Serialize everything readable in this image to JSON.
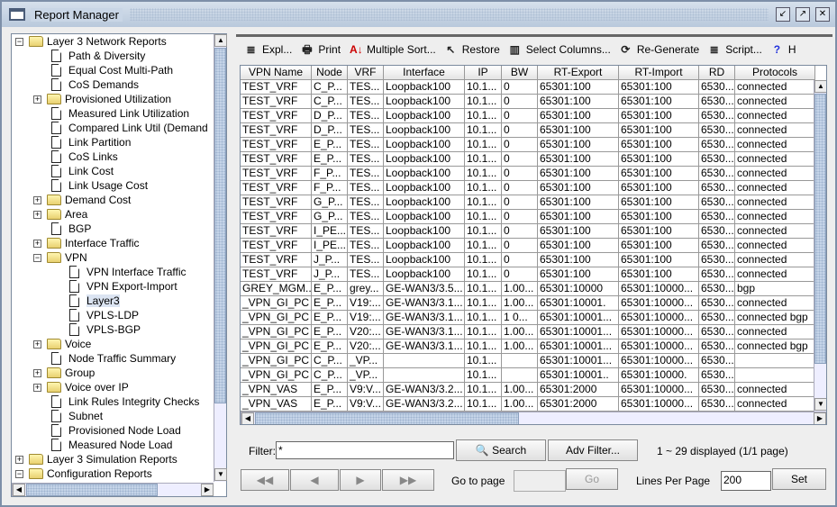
{
  "window": {
    "title": "Report Manager",
    "controls": [
      "minimize",
      "maximize",
      "close"
    ]
  },
  "tree": [
    {
      "label": "Layer 3 Network Reports",
      "type": "folder",
      "level": 0,
      "expanded": true
    },
    {
      "label": "Path & Diversity",
      "type": "doc",
      "level": 1
    },
    {
      "label": "Equal Cost Multi-Path",
      "type": "doc",
      "level": 1
    },
    {
      "label": "CoS Demands",
      "type": "doc",
      "level": 1
    },
    {
      "label": "Provisioned Utilization",
      "type": "folder",
      "level": 1,
      "expanded": false
    },
    {
      "label": "Measured Link Utilization",
      "type": "doc",
      "level": 1
    },
    {
      "label": "Compared Link Util (Demand",
      "type": "doc",
      "level": 1
    },
    {
      "label": "Link Partition",
      "type": "doc",
      "level": 1
    },
    {
      "label": "CoS Links",
      "type": "doc",
      "level": 1
    },
    {
      "label": "Link Cost",
      "type": "doc",
      "level": 1
    },
    {
      "label": "Link Usage Cost",
      "type": "doc",
      "level": 1
    },
    {
      "label": "Demand Cost",
      "type": "folder",
      "level": 1,
      "expanded": false
    },
    {
      "label": "Area",
      "type": "folder",
      "level": 1,
      "expanded": false
    },
    {
      "label": "BGP",
      "type": "doc",
      "level": 1
    },
    {
      "label": "Interface Traffic",
      "type": "folder",
      "level": 1,
      "expanded": false
    },
    {
      "label": "VPN",
      "type": "folder",
      "level": 1,
      "expanded": true
    },
    {
      "label": "VPN Interface Traffic",
      "type": "doc",
      "level": 2
    },
    {
      "label": "VPN Export-Import",
      "type": "doc",
      "level": 2
    },
    {
      "label": "Layer3",
      "type": "doc",
      "level": 2,
      "selected": true
    },
    {
      "label": "VPLS-LDP",
      "type": "doc",
      "level": 2
    },
    {
      "label": "VPLS-BGP",
      "type": "doc",
      "level": 2
    },
    {
      "label": "Voice",
      "type": "folder",
      "level": 1,
      "expanded": false
    },
    {
      "label": "Node Traffic Summary",
      "type": "doc",
      "level": 1
    },
    {
      "label": "Group",
      "type": "folder",
      "level": 1,
      "expanded": false
    },
    {
      "label": "Voice over IP",
      "type": "folder",
      "level": 1,
      "expanded": false
    },
    {
      "label": "Link Rules Integrity Checks",
      "type": "doc",
      "level": 1
    },
    {
      "label": "Subnet",
      "type": "doc",
      "level": 1
    },
    {
      "label": "Provisioned Node Load",
      "type": "doc",
      "level": 1
    },
    {
      "label": "Measured Node Load",
      "type": "doc",
      "level": 1
    },
    {
      "label": "Layer 3 Simulation Reports",
      "type": "folder",
      "level": 0,
      "expanded": false
    },
    {
      "label": "Configuration Reports",
      "type": "folder",
      "level": 0,
      "expanded": true
    }
  ],
  "toolbar": [
    {
      "label": "Expl...",
      "icon": "document-icon",
      "glyph": "≣"
    },
    {
      "label": "Print",
      "icon": "printer-icon",
      "glyph": "🖶"
    },
    {
      "label": "Multiple Sort...",
      "icon": "sort-icon",
      "glyph": "A↓"
    },
    {
      "label": "Restore",
      "icon": "restore-icon",
      "glyph": "↖"
    },
    {
      "label": "Select Columns...",
      "icon": "columns-icon",
      "glyph": "▥"
    },
    {
      "label": "Re-Generate",
      "icon": "refresh-icon",
      "glyph": "⟳"
    },
    {
      "label": "Script...",
      "icon": "script-icon",
      "glyph": "≣"
    },
    {
      "label": "H",
      "icon": "help-icon",
      "glyph": "?"
    }
  ],
  "table": {
    "columns": [
      "VPN Name",
      "Node",
      "VRF",
      "Interface",
      "IP",
      "BW",
      "RT-Export",
      "RT-Import",
      "RD",
      "Protocols"
    ],
    "rows": [
      [
        "TEST_VRF",
        "C_P...",
        "TES...",
        "Loopback100",
        "10.1...",
        "0",
        "65301:100",
        "65301:100",
        "6530...",
        "connected"
      ],
      [
        "TEST_VRF",
        "C_P...",
        "TES...",
        "Loopback100",
        "10.1...",
        "0",
        "65301:100",
        "65301:100",
        "6530...",
        "connected"
      ],
      [
        "TEST_VRF",
        "D_P...",
        "TES...",
        "Loopback100",
        "10.1...",
        "0",
        "65301:100",
        "65301:100",
        "6530...",
        "connected"
      ],
      [
        "TEST_VRF",
        "D_P...",
        "TES...",
        "Loopback100",
        "10.1...",
        "0",
        "65301:100",
        "65301:100",
        "6530...",
        "connected"
      ],
      [
        "TEST_VRF",
        "E_P...",
        "TES...",
        "Loopback100",
        "10.1...",
        "0",
        "65301:100",
        "65301:100",
        "6530...",
        "connected"
      ],
      [
        "TEST_VRF",
        "E_P...",
        "TES...",
        "Loopback100",
        "10.1...",
        "0",
        "65301:100",
        "65301:100",
        "6530...",
        "connected"
      ],
      [
        "TEST_VRF",
        "F_P...",
        "TES...",
        "Loopback100",
        "10.1...",
        "0",
        "65301:100",
        "65301:100",
        "6530...",
        "connected"
      ],
      [
        "TEST_VRF",
        "F_P...",
        "TES...",
        "Loopback100",
        "10.1...",
        "0",
        "65301:100",
        "65301:100",
        "6530...",
        "connected"
      ],
      [
        "TEST_VRF",
        "G_P...",
        "TES...",
        "Loopback100",
        "10.1...",
        "0",
        "65301:100",
        "65301:100",
        "6530...",
        "connected"
      ],
      [
        "TEST_VRF",
        "G_P...",
        "TES...",
        "Loopback100",
        "10.1...",
        "0",
        "65301:100",
        "65301:100",
        "6530...",
        "connected"
      ],
      [
        "TEST_VRF",
        "I_PE...",
        "TES...",
        "Loopback100",
        "10.1...",
        "0",
        "65301:100",
        "65301:100",
        "6530...",
        "connected"
      ],
      [
        "TEST_VRF",
        "I_PE...",
        "TES...",
        "Loopback100",
        "10.1...",
        "0",
        "65301:100",
        "65301:100",
        "6530...",
        "connected"
      ],
      [
        "TEST_VRF",
        "J_P...",
        "TES...",
        "Loopback100",
        "10.1...",
        "0",
        "65301:100",
        "65301:100",
        "6530...",
        "connected"
      ],
      [
        "TEST_VRF",
        "J_P...",
        "TES...",
        "Loopback100",
        "10.1...",
        "0",
        "65301:100",
        "65301:100",
        "6530...",
        "connected"
      ],
      [
        "GREY_MGM...",
        "E_P...",
        "grey...",
        "GE-WAN3/3.5...",
        "10.1...",
        "1.00...",
        "65301:10000",
        "65301:10000...",
        "6530...",
        "bgp"
      ],
      [
        "_VPN_GI_PC",
        "E_P...",
        "V19:...",
        "GE-WAN3/3.1...",
        "10.1...",
        "1.00...",
        "65301:10001.",
        "65301:10000...",
        "6530...",
        "connected"
      ],
      [
        "_VPN_GI_PC",
        "E_P...",
        "V19:...",
        "GE-WAN3/3.1...",
        "10.1...",
        "1   0...",
        "65301:10001...",
        "65301:10000...",
        "6530...",
        "connected bgp"
      ],
      [
        "_VPN_GI_PC",
        "E_P...",
        "V20:...",
        "GE-WAN3/3.1...",
        "10.1...",
        "1.00...",
        "65301:10001...",
        "65301:10000...",
        "6530...",
        "connected"
      ],
      [
        "_VPN_GI_PC",
        "E_P...",
        "V20:...",
        "GE-WAN3/3.1...",
        "10.1...",
        "1.00...",
        "65301:10001...",
        "65301:10000...",
        "6530...",
        "connected bgp"
      ],
      [
        "_VPN_GI_PC",
        "C_P...",
        "_VP...",
        "",
        "10.1...",
        "",
        "65301:10001...",
        "65301:10000...",
        "6530...",
        ""
      ],
      [
        "_VPN_GI_PC",
        "C_P...",
        "_VP...",
        "",
        "10.1...",
        "",
        "65301:10001..",
        "65301:10000.",
        "6530...",
        ""
      ],
      [
        "_VPN_VAS",
        "E_P...",
        "V9:V...",
        "GE-WAN3/3.2...",
        "10.1...",
        "1.00...",
        "65301:2000",
        "65301:10000...",
        "6530...",
        "connected"
      ],
      [
        "_VPN_VAS",
        "E_P...",
        "V9:V...",
        "GE-WAN3/3.2...",
        "10.1...",
        "1.00...",
        "65301:2000",
        "65301:10000...",
        "6530...",
        "connected"
      ],
      [
        "_VPN_VAS",
        "E_P...",
        "V9:V...",
        "GE-WAN3/3.2...",
        "10.1...",
        "1.00...",
        "65301:2000",
        "65301:10000...",
        "6530...",
        "connected bgp"
      ]
    ]
  },
  "filter": {
    "label": "Filter:",
    "value": "*",
    "search": "Search",
    "adv": "Adv Filter...",
    "status": "1 ~ 29 displayed (1/1 page)"
  },
  "pager": {
    "goto_label": "Go to page",
    "goto_value": "",
    "go": "Go",
    "lines_label": "Lines Per Page",
    "lines_value": "200",
    "set": "Set"
  }
}
